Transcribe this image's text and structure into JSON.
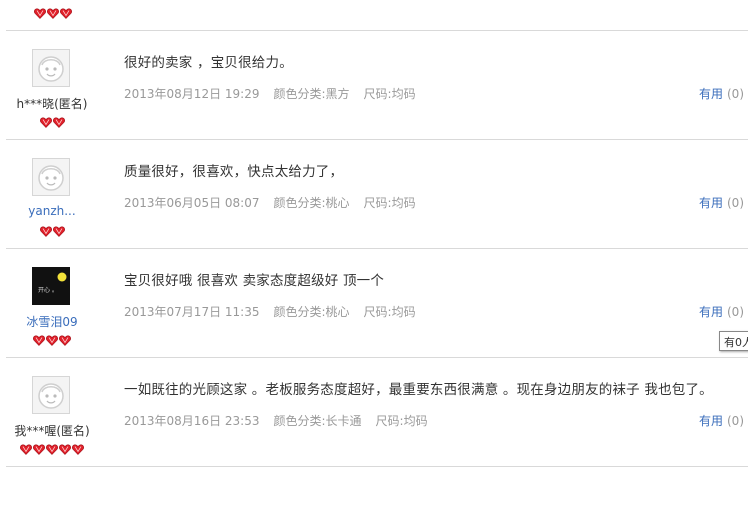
{
  "top": {
    "hearts": 3
  },
  "reviews": [
    {
      "user": "h***晓(匿名)",
      "avatar": "default-avatar-icon",
      "hearts": 2,
      "content": "很好的卖家 ，宝贝很给力。",
      "datetime": "2013年08月12日 19:29",
      "color_class": "颜色分类:黑方",
      "size": "尺码:均码",
      "useful_label": "有用",
      "useful_count": "(0)"
    },
    {
      "user": "yanzh...",
      "avatar": "default-avatar-icon",
      "hearts": 2,
      "content": "质量很好，很喜欢，快点太给力了，",
      "datetime": "2013年06月05日 08:07",
      "color_class": "颜色分类:桃心",
      "size": "尺码:均码",
      "useful_label": "有用",
      "useful_count": "(0)"
    },
    {
      "user": "冰雪泪09",
      "avatar": "custom-avatar-icon",
      "avatar_text": "开心 。",
      "hearts": 3,
      "content": "宝贝很好哦 很喜欢 卖家态度超级好 顶一个",
      "datetime": "2013年07月17日 11:35",
      "color_class": "颜色分类:桃心",
      "size": "尺码:均码",
      "useful_label": "有用",
      "useful_count": "(0)"
    },
    {
      "user": "我***喔(匿名)",
      "avatar": "default-avatar-icon",
      "hearts": 5,
      "content": "一如既往的光顾这家 。老板服务态度超好，最重要东西很满意 。现在身边朋友的袜子 我也包了。",
      "datetime": "2013年08月16日 23:53",
      "color_class": "颜色分类:长卡通",
      "size": "尺码:均码",
      "useful_label": "有用",
      "useful_count": "(0)"
    }
  ],
  "tooltip": "有0人",
  "colors": {
    "link": "#3a6dbb",
    "meta": "#999999",
    "heart": "#e0202a",
    "divider": "#d9d9d9"
  }
}
